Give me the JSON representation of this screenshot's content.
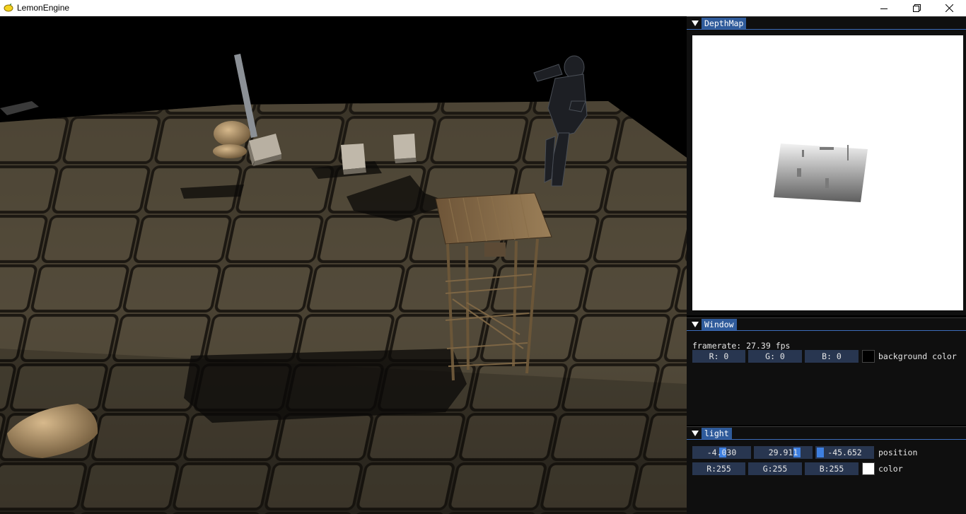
{
  "window": {
    "title": "LemonEngine"
  },
  "panels": {
    "depthmap": {
      "title": "DepthMap"
    },
    "window": {
      "title": "Window",
      "framerate": "framerate: 27.39 fps",
      "bg_r": "R:  0",
      "bg_g": "G:  0",
      "bg_b": "B:  0",
      "bg_label": "background color",
      "bg_swatch_color": "#000000"
    },
    "light": {
      "title": "light",
      "pos_x": "-4.030",
      "pos_y": "29.911",
      "pos_z": "-45.652",
      "pos_label": "position",
      "col_r": "R:255",
      "col_g": "G:255",
      "col_b": "B:255",
      "col_label": "color",
      "col_swatch_color": "#ffffff"
    }
  },
  "colors": {
    "accent": "#2f5b9b",
    "field_bg": "#283650",
    "slider_grab": "#3e7fe0"
  }
}
